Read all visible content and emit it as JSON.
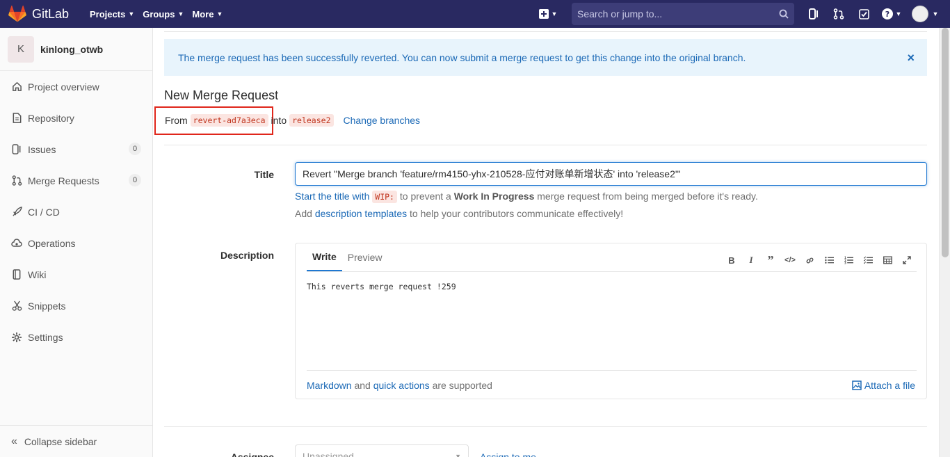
{
  "navbar": {
    "brand": "GitLab",
    "menus": [
      {
        "label": "Projects"
      },
      {
        "label": "Groups"
      },
      {
        "label": "More"
      }
    ],
    "search_placeholder": "Search or jump to...",
    "bg_color": "#292961"
  },
  "sidebar": {
    "project_initial": "K",
    "project_name": "kinlong_otwb",
    "items": [
      {
        "label": "Project overview",
        "icon": "home-icon"
      },
      {
        "label": "Repository",
        "icon": "document-icon"
      },
      {
        "label": "Issues",
        "icon": "issues-icon",
        "count": "0"
      },
      {
        "label": "Merge Requests",
        "icon": "merge-request-icon",
        "count": "0"
      },
      {
        "label": "CI / CD",
        "icon": "rocket-icon"
      },
      {
        "label": "Operations",
        "icon": "cloud-gear-icon"
      },
      {
        "label": "Wiki",
        "icon": "book-icon"
      },
      {
        "label": "Snippets",
        "icon": "scissors-icon"
      },
      {
        "label": "Settings",
        "icon": "gear-icon"
      }
    ],
    "collapse_label": "Collapse sidebar"
  },
  "alert": {
    "message": "The merge request has been successfully reverted. You can now submit a merge request to get this change into the original branch.",
    "close": "×"
  },
  "page": {
    "title": "New Merge Request",
    "from_label": "From",
    "source_branch": "revert-ad7a3eca",
    "into_label": "into",
    "target_branch": "release2",
    "change_branches": "Change branches"
  },
  "form": {
    "title_label": "Title",
    "title_value": "Revert \"Merge branch 'feature/rm4150-yhx-210528-应付对账单新增状态' into 'release2'\"",
    "wip_help_prefix": "Start the title with",
    "wip_code": "WIP:",
    "wip_help_mid": "to prevent a",
    "wip_help_bold": "Work In Progress",
    "wip_help_suffix": "merge request from being merged before it's ready.",
    "templates_prefix": "Add",
    "templates_link": "description templates",
    "templates_suffix": "to help your contributors communicate effectively!",
    "description_label": "Description",
    "tab_write": "Write",
    "tab_preview": "Preview",
    "description_value": "This reverts merge request !259",
    "markdown_link": "Markdown",
    "and_text": "and",
    "quick_actions_link": "quick actions",
    "supported_text": "are supported",
    "attach_label": "Attach a file",
    "assignee_label": "Assignee",
    "assignee_value": "Unassigned",
    "assign_me": "Assign to me"
  },
  "colors": {
    "link": "#1b69b6",
    "highlight": "#e0261b",
    "alert_bg": "#e8f4fc"
  }
}
